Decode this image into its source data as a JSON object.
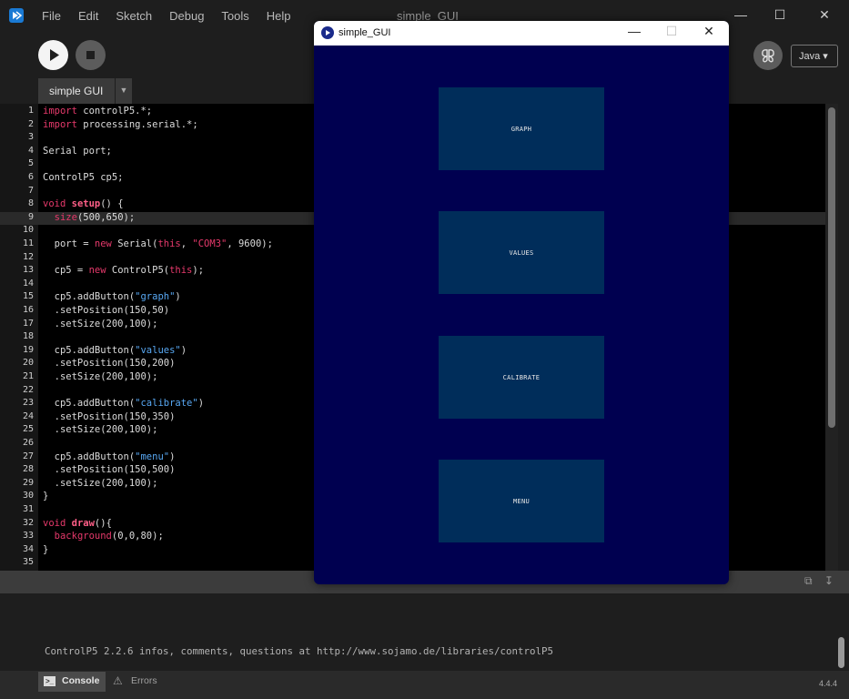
{
  "ide": {
    "menu": [
      "File",
      "Edit",
      "Sketch",
      "Debug",
      "Tools",
      "Help"
    ],
    "window_title": "simple_GUI",
    "tab_label": "simple GUI",
    "mode": "Java ▾",
    "version": "4.4.4"
  },
  "code_lines": [
    {
      "n": "1",
      "html": "<span class='kw'>import</span> controlP5.*;"
    },
    {
      "n": "2",
      "html": "<span class='kw'>import</span> processing.serial.*;"
    },
    {
      "n": "3",
      "html": ""
    },
    {
      "n": "4",
      "html": "Serial port;"
    },
    {
      "n": "5",
      "html": ""
    },
    {
      "n": "6",
      "html": "ControlP5 cp5;"
    },
    {
      "n": "7",
      "html": ""
    },
    {
      "n": "8",
      "html": "<span class='kw'>void</span> <span class='fn'>setup</span>() {"
    },
    {
      "n": "9",
      "html": "  <span class='kw'>size</span>(500,650);",
      "current": true
    },
    {
      "n": "10",
      "html": ""
    },
    {
      "n": "11",
      "html": "  port = <span class='kw'>new</span> Serial(<span class='kw'>this</span>, <span class='kw'>\"COM3\"</span>, 9600);"
    },
    {
      "n": "12",
      "html": ""
    },
    {
      "n": "13",
      "html": "  cp5 = <span class='kw'>new</span> ControlP5(<span class='kw'>this</span>);"
    },
    {
      "n": "14",
      "html": ""
    },
    {
      "n": "15",
      "html": "  cp5.addButton(<span class='str'>\"graph\"</span>)"
    },
    {
      "n": "16",
      "html": "  .setPosition(150,50)"
    },
    {
      "n": "17",
      "html": "  .setSize(200,100);"
    },
    {
      "n": "18",
      "html": ""
    },
    {
      "n": "19",
      "html": "  cp5.addButton(<span class='str'>\"values\"</span>)"
    },
    {
      "n": "20",
      "html": "  .setPosition(150,200)"
    },
    {
      "n": "21",
      "html": "  .setSize(200,100);"
    },
    {
      "n": "22",
      "html": ""
    },
    {
      "n": "23",
      "html": "  cp5.addButton(<span class='str'>\"calibrate\"</span>)"
    },
    {
      "n": "24",
      "html": "  .setPosition(150,350)"
    },
    {
      "n": "25",
      "html": "  .setSize(200,100);"
    },
    {
      "n": "26",
      "html": ""
    },
    {
      "n": "27",
      "html": "  cp5.addButton(<span class='str'>\"menu\"</span>)"
    },
    {
      "n": "28",
      "html": "  .setPosition(150,500)"
    },
    {
      "n": "29",
      "html": "  .setSize(200,100);"
    },
    {
      "n": "30",
      "html": "}"
    },
    {
      "n": "31",
      "html": ""
    },
    {
      "n": "32",
      "html": "<span class='kw'>void</span> <span class='fn'>draw</span>(){"
    },
    {
      "n": "33",
      "html": "  <span class='kw'>background</span>(0,0,80);"
    },
    {
      "n": "34",
      "html": "}"
    },
    {
      "n": "35",
      "html": ""
    }
  ],
  "console": {
    "message": "ControlP5 2.2.6 infos, comments, questions at http://www.sojamo.de/libraries/controlP5",
    "console_tab": "Console",
    "errors_tab": "Errors"
  },
  "sketch_window": {
    "title": "simple_GUI",
    "background": "#000050",
    "button_color": "#002d5a",
    "buttons": [
      "GRAPH",
      "VALUES",
      "CALIBRATE",
      "MENU"
    ]
  }
}
